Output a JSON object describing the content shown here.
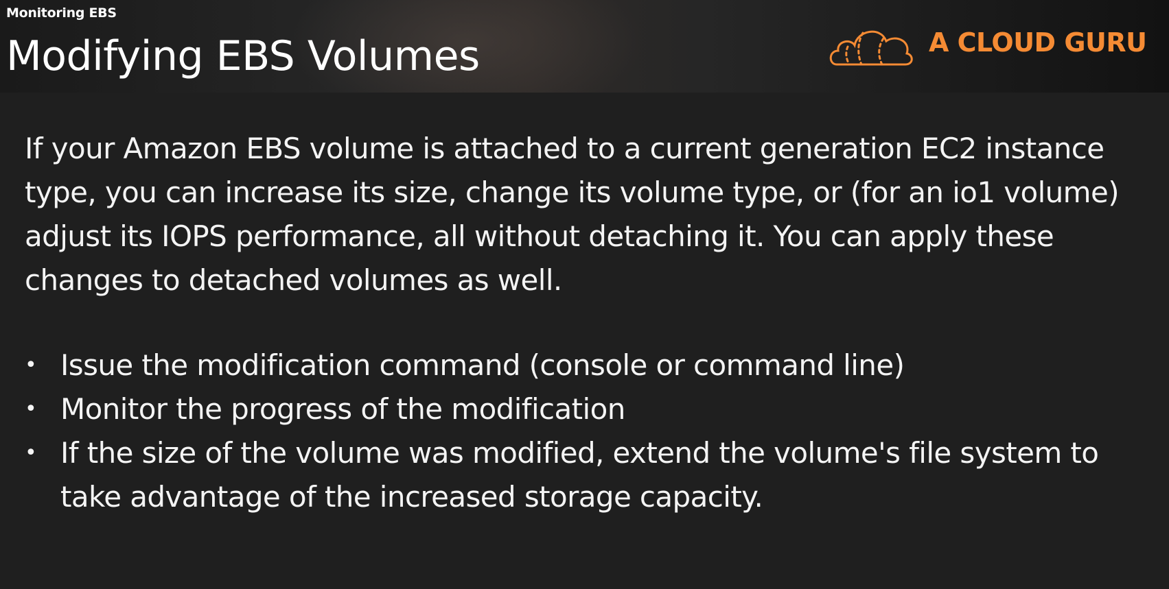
{
  "header": {
    "section_label": "Monitoring EBS",
    "title": "Modifying EBS Volumes",
    "logo_text": "A CLOUD GURU",
    "logo_icon": "cloud-icon"
  },
  "colors": {
    "background": "#1f1f1f",
    "text": "#f4f4f4",
    "brand_orange": "#f58b34"
  },
  "body": {
    "paragraph": "If your Amazon EBS volume is attached to a current generation EC2 instance type, you can increase its size, change its volume type, or (for an io1 volume) adjust its IOPS performance, all without detaching it. You can apply these changes to detached volumes as well.",
    "bullets": [
      {
        "text": "Issue the modification command (console or command line)"
      },
      {
        "text": "Monitor the progress of the modification"
      },
      {
        "text": "If the size of the volume was modified, extend the volume's file system to take advantage of the increased storage capacity."
      }
    ],
    "bullet_glyph": "•"
  }
}
